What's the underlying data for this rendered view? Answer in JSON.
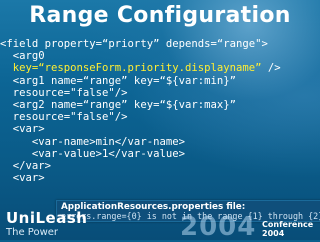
{
  "slide": {
    "title": "Range Configuration",
    "code_lines": [
      {
        "parts": [
          {
            "t": "<field property=“priorty” depends=“range\">",
            "y": false
          }
        ]
      },
      {
        "parts": [
          {
            "t": "  <arg0",
            "y": false
          }
        ]
      },
      {
        "parts": [
          {
            "t": "  key=“responseForm.priority.displayname”",
            "y": true
          },
          {
            "t": " />",
            "y": false
          }
        ]
      },
      {
        "parts": [
          {
            "t": "  <arg1 name=“range” key=“${var:min}”",
            "y": false
          }
        ]
      },
      {
        "parts": [
          {
            "t": "  resource=\"false\"/>",
            "y": false
          }
        ]
      },
      {
        "parts": [
          {
            "t": "  <arg2 name=“range” key=“${var:max}”",
            "y": false
          }
        ]
      },
      {
        "parts": [
          {
            "t": "  resource=\"false\"/>",
            "y": false
          }
        ]
      },
      {
        "parts": [
          {
            "t": "  <var>",
            "y": false
          }
        ]
      },
      {
        "parts": [
          {
            "t": "     <var-name>min</var-name>",
            "y": false
          }
        ]
      },
      {
        "parts": [
          {
            "t": "     <var-value>1</var-value>",
            "y": false
          }
        ]
      },
      {
        "parts": [
          {
            "t": "  </var>",
            "y": false
          }
        ]
      },
      {
        "parts": [
          {
            "t": "  <var>",
            "y": false
          }
        ]
      }
    ]
  },
  "tooltip": {
    "title": "ApplicationResources.properties file:",
    "body": "errors.range={0} is not in the range {1} through {2}."
  },
  "branding": {
    "name": "UniLeash",
    "tagline": "The Power",
    "year": "2004",
    "conference_line1": "Conference",
    "conference_line2": "2004"
  },
  "colors": {
    "background": "#0a5f8c",
    "code_text": "#ffffff",
    "code_highlight": "#ffee33"
  }
}
